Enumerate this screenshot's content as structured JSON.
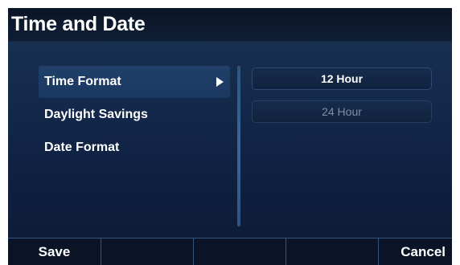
{
  "header": {
    "title": "Time and Date"
  },
  "menu": {
    "items": [
      {
        "label": "Time Format",
        "selected": true
      },
      {
        "label": "Daylight Savings",
        "selected": false
      },
      {
        "label": "Date Format",
        "selected": false
      }
    ]
  },
  "options": [
    {
      "label": "12 Hour",
      "enabled": true
    },
    {
      "label": "24 Hour",
      "enabled": false
    }
  ],
  "softkeys": [
    {
      "label": "Save"
    },
    {
      "label": ""
    },
    {
      "label": ""
    },
    {
      "label": ""
    },
    {
      "label": "Cancel"
    }
  ],
  "icons": {
    "submenu_arrow": "arrow-right-icon"
  },
  "colors": {
    "background": "#0a1426",
    "selected_item": "#1c3a63",
    "divider": "#3a6798",
    "disabled_text": "#7d8ea6"
  }
}
